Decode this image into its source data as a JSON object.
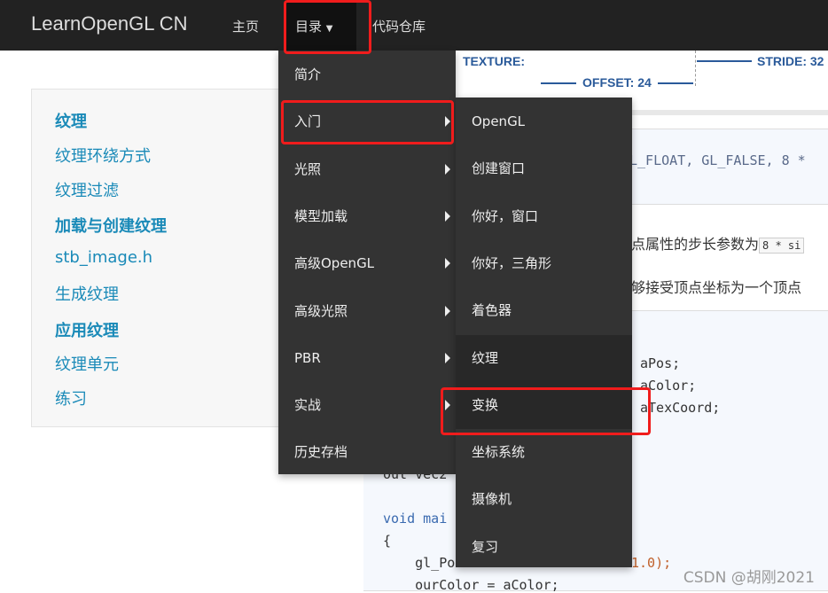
{
  "navbar": {
    "brand": "LearnOpenGL CN",
    "home": "主页",
    "catalog": "目录",
    "repo": "代码仓库"
  },
  "sidebar": {
    "items": [
      {
        "label": "纹理",
        "bold": true
      },
      {
        "label": "纹理环绕方式",
        "bold": false
      },
      {
        "label": "纹理过滤",
        "bold": false
      },
      {
        "label": "加载与创建纹理",
        "bold": true
      },
      {
        "label": "stb_image.h",
        "bold": false
      },
      {
        "label": "生成纹理",
        "bold": false
      },
      {
        "label": "应用纹理",
        "bold": true
      },
      {
        "label": "纹理单元",
        "bold": false
      },
      {
        "label": "练习",
        "bold": false
      }
    ]
  },
  "diagram": {
    "texture": "TEXTURE:",
    "offset": "OFFSET: 24",
    "stride": "STRIDE: 32"
  },
  "content": {
    "code1": "L_FLOAT, GL_FALSE, 8 *",
    "text1": "点属性的步长参数为",
    "text1_code": "8 * si",
    "text2": "够接受顶点坐标为一个顶点",
    "code2": [
      "aPos;",
      "aColor;",
      "aTexCoord;"
    ],
    "code3": [
      "out vec2",
      "",
      "void mai",
      "{",
      "    gl_Po",
      "    ourColor = aColor;"
    ],
    "code3_tail": "1.0);"
  },
  "menu": {
    "items": [
      {
        "label": "简介",
        "submenu": false
      },
      {
        "label": "入门",
        "submenu": true
      },
      {
        "label": "光照",
        "submenu": true
      },
      {
        "label": "模型加载",
        "submenu": true
      },
      {
        "label": "高级OpenGL",
        "submenu": true
      },
      {
        "label": "高级光照",
        "submenu": true
      },
      {
        "label": "PBR",
        "submenu": true
      },
      {
        "label": "实战",
        "submenu": true
      },
      {
        "label": "历史存档",
        "submenu": false
      }
    ]
  },
  "submenu": {
    "items": [
      "OpenGL",
      "创建窗口",
      "你好，窗口",
      "你好，三角形",
      "着色器",
      "纹理",
      "变换",
      "坐标系统",
      "摄像机",
      "复习"
    ]
  },
  "watermark": "CSDN @胡刚2021",
  "colors": {
    "navbar": "#222222",
    "menu": "#333333",
    "link": "#1a8ab8",
    "highlight": "#f01c1c"
  }
}
